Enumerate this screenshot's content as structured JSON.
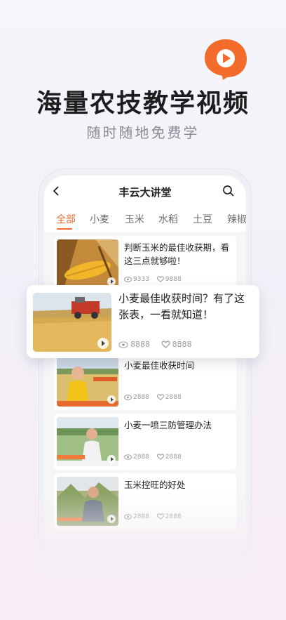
{
  "headline": "海量农技教学视频",
  "subline": "随时随地免费学",
  "nav": {
    "title": "丰云大讲堂"
  },
  "tabs": [
    "全部",
    "小麦",
    "玉米",
    "水稻",
    "土豆",
    "辣椒"
  ],
  "featured": {
    "title": "小麦最佳收获时间？有了这张表，一看就知道！",
    "views": "8888",
    "likes": "8888"
  },
  "videos": [
    {
      "title": "判断玉米的最佳收获期，看这三点就够啦！",
      "views": "9333",
      "likes": "9888"
    },
    {
      "title": "小麦最佳收获时间",
      "views": "2888",
      "likes": "2888"
    },
    {
      "title": "小麦一喷三防管理办法",
      "views": "2888",
      "likes": "2888"
    },
    {
      "title": "玉米控旺的好处",
      "views": "2888",
      "likes": "2888"
    }
  ],
  "colors": {
    "accent": "#f06a2c",
    "logo": "#f26b2a"
  }
}
